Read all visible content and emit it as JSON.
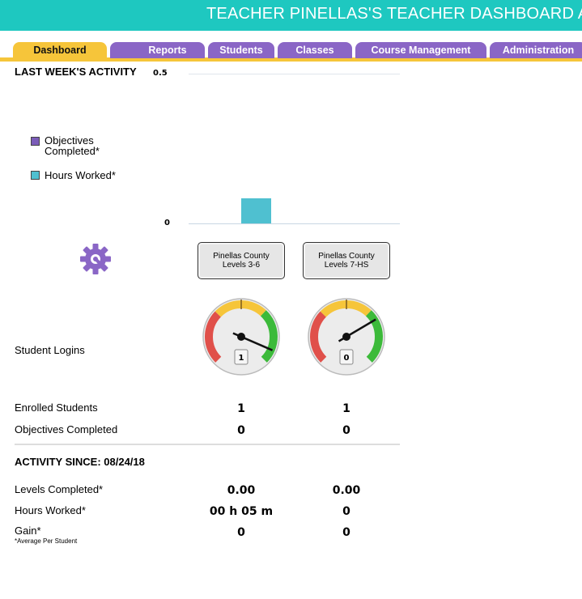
{
  "header": {
    "title": "TEACHER PINELLAS'S TEACHER DASHBOARD AS"
  },
  "tabs": [
    {
      "label": "Dashboard",
      "active": true
    },
    {
      "label": "Reports",
      "active": false
    },
    {
      "label": "Students",
      "active": false
    },
    {
      "label": "Classes",
      "active": false
    },
    {
      "label": "Course Management",
      "active": false
    },
    {
      "label": "Administration",
      "active": false
    }
  ],
  "activity": {
    "heading": "LAST WEEK'S ACTIVITY",
    "y_max_label": "0.5",
    "y_min_label": "0",
    "legend": [
      {
        "label": "Objectives Completed*",
        "color": "#7b5cb8"
      },
      {
        "label": "Hours Worked*",
        "color": "#4fc0d0"
      }
    ]
  },
  "chart_data": {
    "type": "bar",
    "categories": [
      "Pinellas County Levels 3-6",
      "Pinellas County Levels 7-HS"
    ],
    "series": [
      {
        "name": "Objectives Completed*",
        "values": [
          0,
          0
        ]
      },
      {
        "name": "Hours Worked*",
        "values": [
          0.083,
          0
        ]
      }
    ],
    "ylim": [
      0,
      0.5
    ]
  },
  "courses": [
    {
      "line1": "Pinellas County",
      "line2": "Levels 3-6",
      "logins": "1",
      "needle_fraction": 0.92,
      "enrolled": "1",
      "objectives": "0",
      "levels": "0.00",
      "hours": "00 h 05 m",
      "gain": "0"
    },
    {
      "line1": "Pinellas County",
      "line2": "Levels 7-HS",
      "logins": "0",
      "needle_fraction": 0.72,
      "enrolled": "1",
      "objectives": "0",
      "levels": "0.00",
      "hours": "0",
      "gain": "0"
    }
  ],
  "labels": {
    "student_logins": "Student Logins",
    "enrolled_students": "Enrolled Students",
    "objectives_completed": "Objectives Completed",
    "activity_since": "ACTIVITY SINCE: 08/24/18",
    "levels_completed": "Levels Completed*",
    "hours_worked": "Hours Worked*",
    "gain": "Gain*",
    "avg_note": "*Average Per Student"
  },
  "colors": {
    "header": "#1ec8c0",
    "tab": "#8a66c6",
    "tab_active": "#f6c53a",
    "gear": "#8a66c6"
  },
  "icons": {
    "settings": "gear-wrench-icon"
  }
}
